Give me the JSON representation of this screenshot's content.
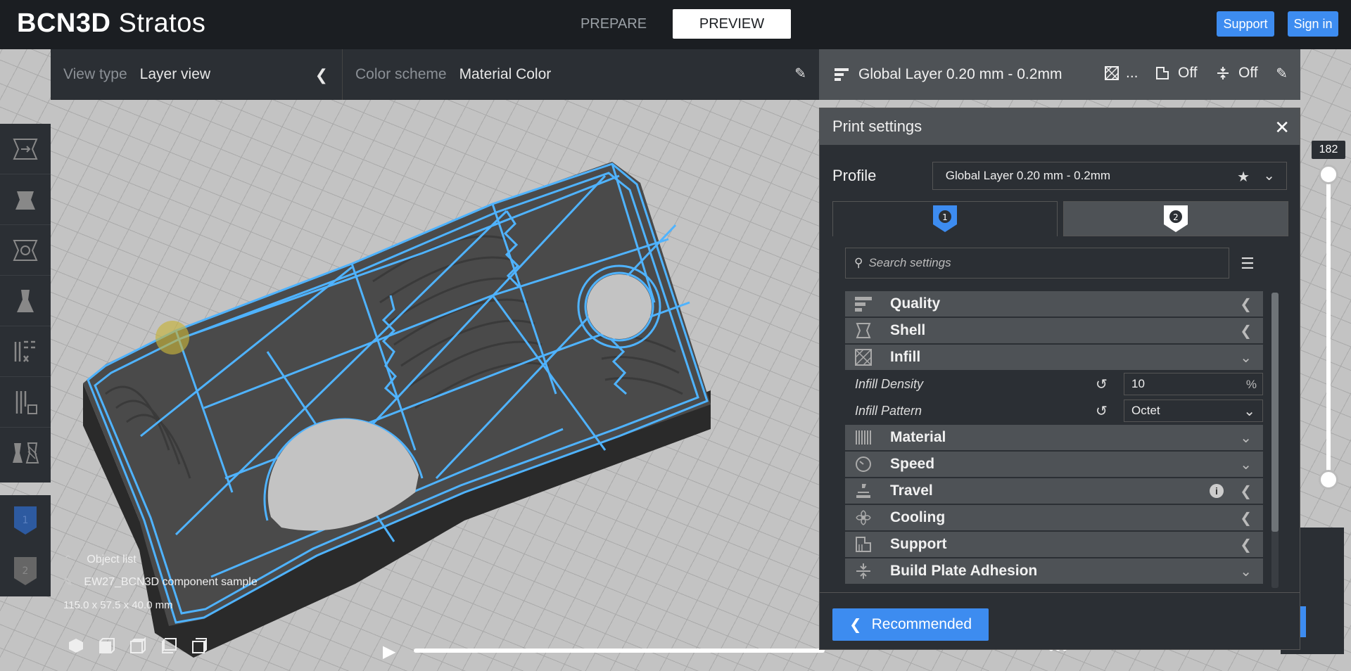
{
  "header": {
    "brand_bold": "BCN3D",
    "brand_light": "Stratos",
    "tabs": [
      {
        "label": "PREPARE",
        "active": false
      },
      {
        "label": "PREVIEW",
        "active": true
      }
    ],
    "support_label": "Support",
    "signin_label": "Sign in"
  },
  "viewbar": {
    "view_type_label": "View type",
    "view_type_value": "Layer view",
    "color_scheme_label": "Color scheme",
    "color_scheme_value": "Material Color"
  },
  "profilebar": {
    "profile_name": "Global Layer 0.20 mm - 0.2mm",
    "infill_value": "...",
    "support_value": "Off",
    "adhesion_value": "Off"
  },
  "object": {
    "list_label": "Object list",
    "name": "EW27_BCN3D component sample",
    "dimensions": "115.0 x 57.5 x 40.0 mm"
  },
  "layer_slider": {
    "top_value": "182"
  },
  "panel": {
    "title": "Print settings",
    "profile_label": "Profile",
    "profile_value": "Global Layer 0.20 mm - 0.2mm",
    "extruders": [
      {
        "number": "1",
        "active": true,
        "color": "#3d8cf0"
      },
      {
        "number": "2",
        "active": false,
        "color": "#ffffff"
      }
    ],
    "search_placeholder": "Search settings",
    "categories": [
      {
        "label": "Quality",
        "icon": "quality-icon",
        "expanded": false
      },
      {
        "label": "Shell",
        "icon": "shell-icon",
        "expanded": false
      },
      {
        "label": "Infill",
        "icon": "infill-icon",
        "expanded": true
      },
      {
        "label": "Material",
        "icon": "material-icon",
        "expanded": true
      },
      {
        "label": "Speed",
        "icon": "speed-icon",
        "expanded": true
      },
      {
        "label": "Travel",
        "icon": "travel-icon",
        "expanded": false
      },
      {
        "label": "Cooling",
        "icon": "cooling-icon",
        "expanded": false
      },
      {
        "label": "Support",
        "icon": "support-icon",
        "expanded": false
      },
      {
        "label": "Build Plate Adhesion",
        "icon": "adhesion-icon",
        "expanded": true
      }
    ],
    "infill_settings": [
      {
        "label": "Infill Density",
        "value": "10",
        "unit": "%"
      },
      {
        "label": "Infill Pattern",
        "value": "Octet"
      }
    ],
    "recommended_label": "Recommended"
  },
  "colors": {
    "accent": "#3d8cf0",
    "panel_bg": "#2b2f34",
    "category_bg": "#4e5256",
    "model_outline": "#4fb3ff"
  }
}
